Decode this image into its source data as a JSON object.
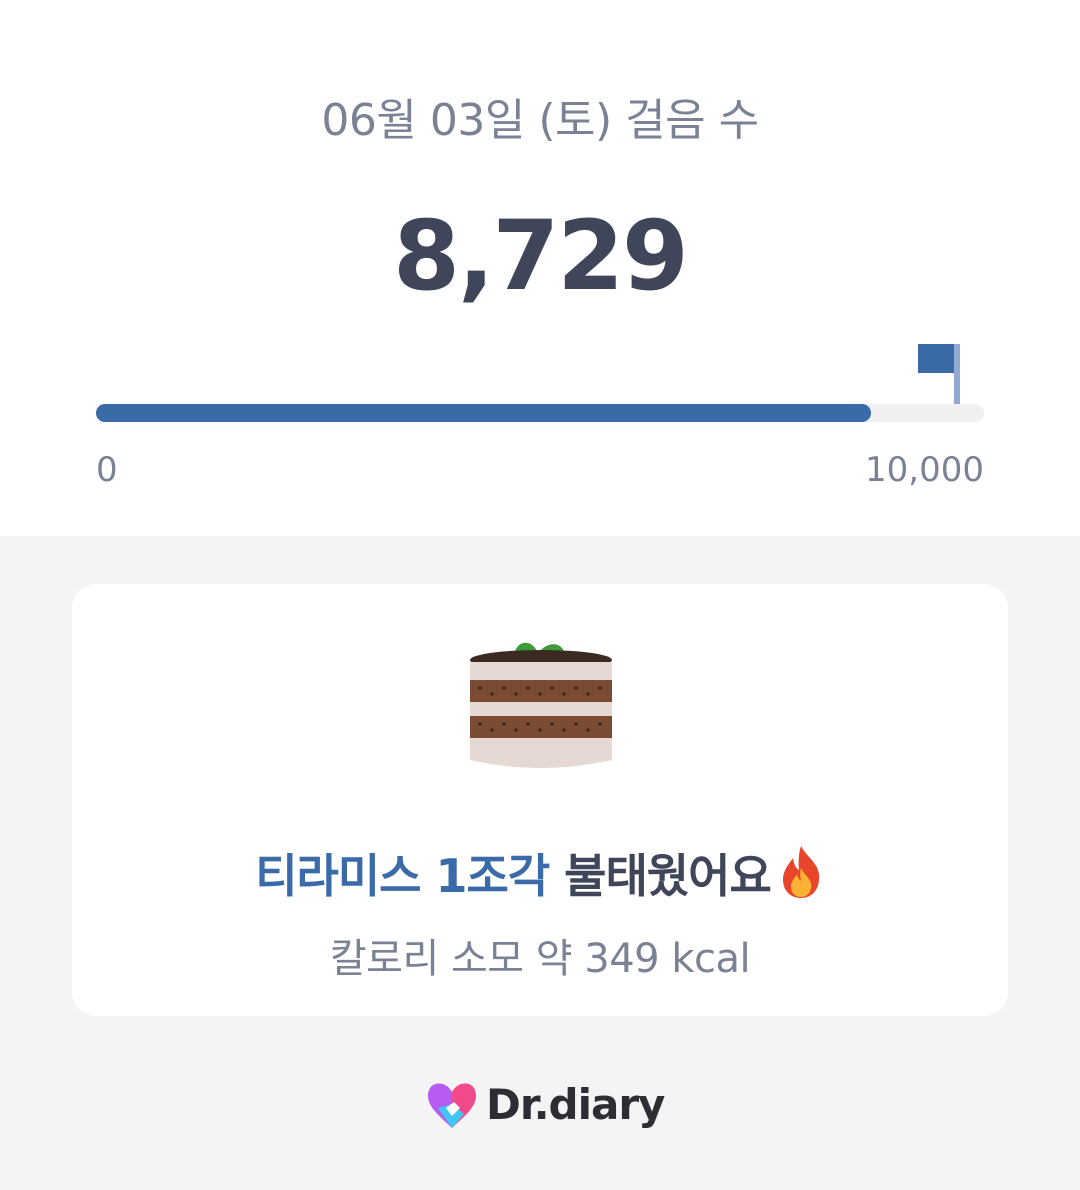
{
  "header": {
    "date_title": "06월 03일 (토) 걸음 수",
    "step_count": "8,729"
  },
  "progress": {
    "current": 8729,
    "goal": 10000,
    "min_label": "0",
    "max_label": "10,000",
    "fill_color": "#3b6aa8",
    "goal_flag_icon": "flag-icon"
  },
  "card": {
    "food_icon": "cake-icon",
    "burn_highlight": "티라미스 1조각",
    "burn_text": " 불태웠어요",
    "burn_icon": "fire-icon",
    "kcal_text": "칼로리 소모 약 349 kcal"
  },
  "footer": {
    "brand_name": "Dr.diary",
    "brand_icon": "heart-logo-icon"
  }
}
